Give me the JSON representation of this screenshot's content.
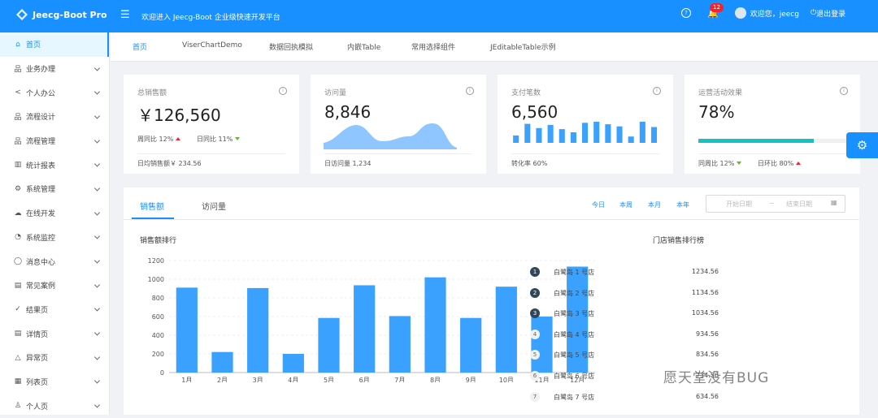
{
  "header": {
    "app_title": "Jeecg-Boot Pro",
    "welcome": "欢迎进入 Jeecg-Boot 企业级快速开发平台",
    "notification_count": "12",
    "user_greeting": "欢迎您，jeecg",
    "logout_label": "退出登录"
  },
  "sidebar": {
    "items": [
      {
        "label": "首页",
        "icon": "home-icon",
        "glyph": "⌂"
      },
      {
        "label": "业务办理",
        "icon": "cluster-icon",
        "glyph": "品"
      },
      {
        "label": "个人办公",
        "icon": "share-icon",
        "glyph": "<"
      },
      {
        "label": "流程设计",
        "icon": "cluster-icon",
        "glyph": "品"
      },
      {
        "label": "流程管理",
        "icon": "cluster-icon",
        "glyph": "品"
      },
      {
        "label": "统计报表",
        "icon": "bar-chart-icon",
        "glyph": "▥"
      },
      {
        "label": "系统管理",
        "icon": "setting-icon",
        "glyph": "⚙"
      },
      {
        "label": "在线开发",
        "icon": "cloud-icon",
        "glyph": "☁"
      },
      {
        "label": "系统监控",
        "icon": "dashboard-icon",
        "glyph": "◔"
      },
      {
        "label": "消息中心",
        "icon": "message-icon",
        "glyph": "◯"
      },
      {
        "label": "常见案例",
        "icon": "book-icon",
        "glyph": "▤"
      },
      {
        "label": "结果页",
        "icon": "check-circle-icon",
        "glyph": "✓"
      },
      {
        "label": "详情页",
        "icon": "profile-icon",
        "glyph": "▤"
      },
      {
        "label": "异常页",
        "icon": "warning-icon",
        "glyph": "△"
      },
      {
        "label": "列表页",
        "icon": "table-icon",
        "glyph": "▦"
      },
      {
        "label": "个人页",
        "icon": "user-icon",
        "glyph": "♙"
      }
    ]
  },
  "tabs": [
    "首页",
    "ViserChartDemo",
    "数据回执模拟",
    "内嵌Table",
    "常用选择组件",
    "JEditableTable示例"
  ],
  "cards": {
    "sales": {
      "title": "总销售额",
      "value": "￥126,560",
      "wow_label": "周同比",
      "wow_value": "12%",
      "dod_label": "日同比",
      "dod_value": "11%",
      "footer": "日均销售额￥ 234.56"
    },
    "visits": {
      "title": "访问量",
      "value": "8,846",
      "footer": "日访问量 1,234"
    },
    "payments": {
      "title": "支付笔数",
      "value": "6,560",
      "footer": "转化率 60%",
      "bars": [
        0.35,
        0.9,
        0.7,
        0.85,
        0.65,
        0.5,
        0.95,
        1.0,
        0.88,
        0.78,
        0.3,
        1.0,
        0.75
      ]
    },
    "operations": {
      "title": "运营活动效果",
      "value": "78%",
      "progress": 0.78,
      "wow_label": "同周比",
      "wow_value": "12%",
      "dod_label": "日环比",
      "dod_value": "80%"
    }
  },
  "panel": {
    "tabs": [
      "销售额",
      "访问量"
    ],
    "ranges": [
      "今日",
      "本周",
      "本月",
      "本年"
    ],
    "start_placeholder": "开始日期",
    "end_placeholder": "结束日期",
    "range_separator": "~",
    "chart_title": "销售额排行",
    "rank_title": "门店销售排行榜"
  },
  "chart_data": {
    "type": "bar",
    "categories": [
      "1月",
      "2月",
      "3月",
      "4月",
      "5月",
      "6月",
      "7月",
      "8月",
      "9月",
      "10月",
      "11月",
      "12月"
    ],
    "values": [
      910,
      220,
      905,
      200,
      585,
      935,
      605,
      1020,
      585,
      920,
      600,
      1135
    ],
    "title": "销售额排行",
    "xlabel": "",
    "ylabel": "",
    "ylim": [
      0,
      1200
    ],
    "yticks": [
      0,
      200,
      400,
      600,
      800,
      1000,
      1200
    ],
    "color": "#3ba1ff",
    "grid": true
  },
  "ranking": [
    {
      "rank": "1",
      "name": "白鹭岛 1 号店",
      "value": "1234.56"
    },
    {
      "rank": "2",
      "name": "白鹭岛 2 号店",
      "value": "1134.56"
    },
    {
      "rank": "3",
      "name": "白鹭岛 3 号店",
      "value": "1034.56"
    },
    {
      "rank": "4",
      "name": "白鹭岛 4 号店",
      "value": "934.56"
    },
    {
      "rank": "5",
      "name": "白鹭岛 5 号店",
      "value": "834.56"
    },
    {
      "rank": "6",
      "name": "白鹭岛 6 号店",
      "value": "734.56"
    },
    {
      "rank": "7",
      "name": "白鹭岛 7 号店",
      "value": "634.56"
    }
  ],
  "watermark": "愿天堂没有BUG",
  "colors": {
    "primary": "#1890ff",
    "bar": "#3ba1ff",
    "progress": "#13c2c2",
    "up": "#f5222d",
    "down": "#52c41a"
  }
}
